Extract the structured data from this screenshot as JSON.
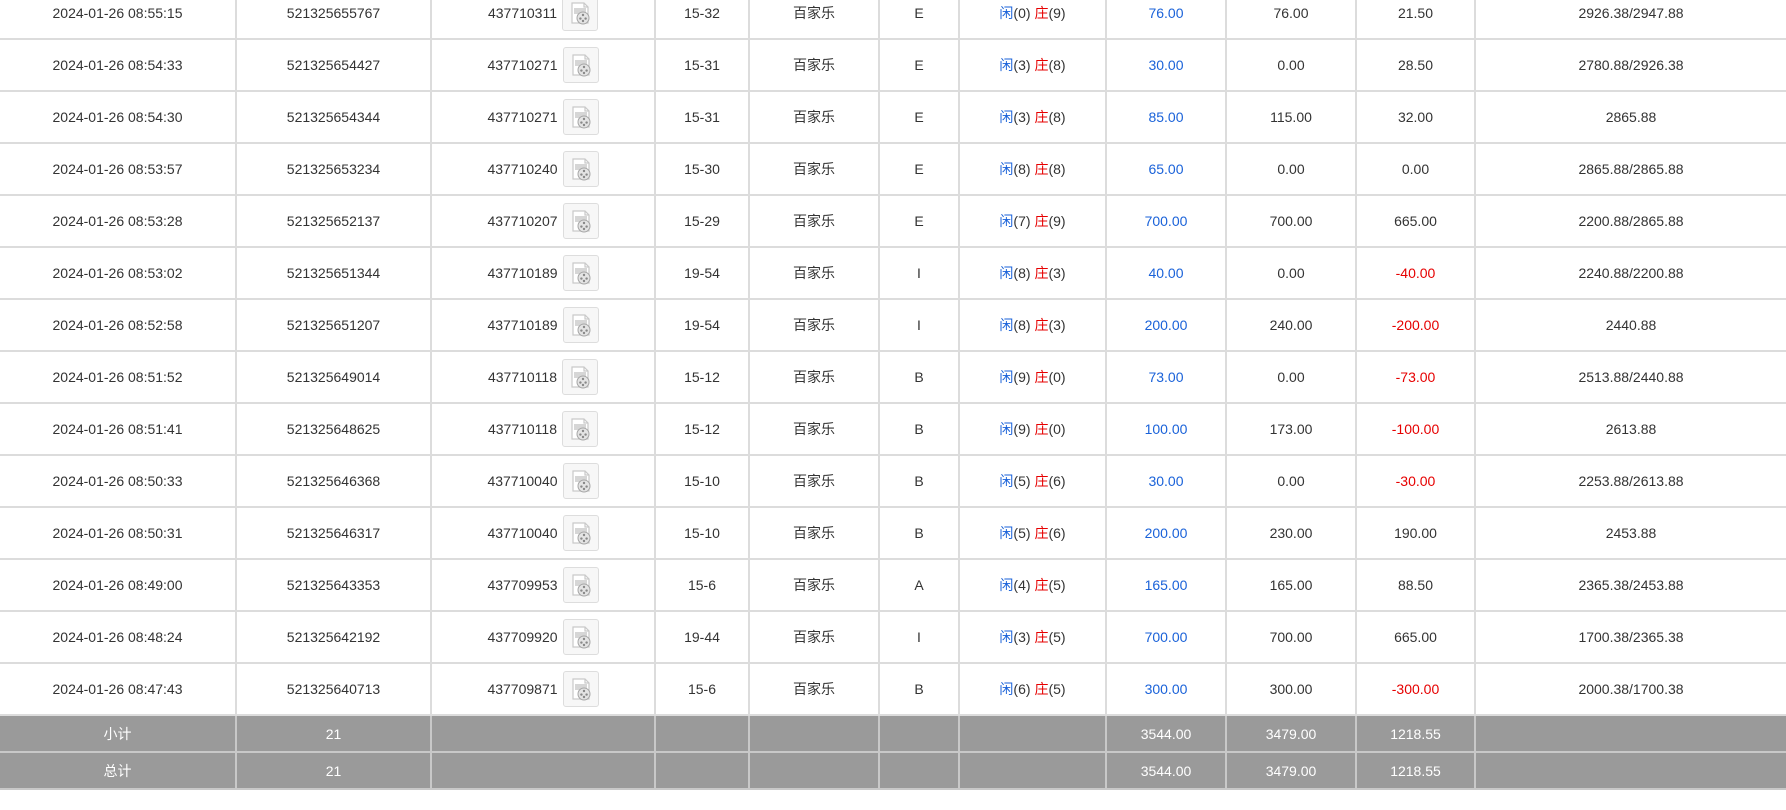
{
  "colors": {
    "bet_blue": "#1a62d9",
    "loss_red": "#e60000",
    "summary_bg": "#9a9a9a",
    "grid": "#dcdcdc"
  },
  "icon": "replay-video-icon",
  "rows": [
    {
      "time": "2024-01-26 08:55:15",
      "order": "521325655767",
      "round": "437710311",
      "table": "15-32",
      "game": "百家乐",
      "seat": "E",
      "p_label": "闲",
      "p_num": "(0)",
      "b_label": "庄",
      "b_num": "(9)",
      "bet": "76.00",
      "valid": "76.00",
      "payout": "21.50",
      "payout_neg": false,
      "balance": "2926.38/2947.88"
    },
    {
      "time": "2024-01-26 08:54:33",
      "order": "521325654427",
      "round": "437710271",
      "table": "15-31",
      "game": "百家乐",
      "seat": "E",
      "p_label": "闲",
      "p_num": "(3)",
      "b_label": "庄",
      "b_num": "(8)",
      "bet": "30.00",
      "valid": "0.00",
      "payout": "28.50",
      "payout_neg": false,
      "balance": "2780.88/2926.38"
    },
    {
      "time": "2024-01-26 08:54:30",
      "order": "521325654344",
      "round": "437710271",
      "table": "15-31",
      "game": "百家乐",
      "seat": "E",
      "p_label": "闲",
      "p_num": "(3)",
      "b_label": "庄",
      "b_num": "(8)",
      "bet": "85.00",
      "valid": "115.00",
      "payout": "32.00",
      "payout_neg": false,
      "balance": "2865.88"
    },
    {
      "time": "2024-01-26 08:53:57",
      "order": "521325653234",
      "round": "437710240",
      "table": "15-30",
      "game": "百家乐",
      "seat": "E",
      "p_label": "闲",
      "p_num": "(8)",
      "b_label": "庄",
      "b_num": "(8)",
      "bet": "65.00",
      "valid": "0.00",
      "payout": "0.00",
      "payout_neg": false,
      "balance": "2865.88/2865.88"
    },
    {
      "time": "2024-01-26 08:53:28",
      "order": "521325652137",
      "round": "437710207",
      "table": "15-29",
      "game": "百家乐",
      "seat": "E",
      "p_label": "闲",
      "p_num": "(7)",
      "b_label": "庄",
      "b_num": "(9)",
      "bet": "700.00",
      "valid": "700.00",
      "payout": "665.00",
      "payout_neg": false,
      "balance": "2200.88/2865.88"
    },
    {
      "time": "2024-01-26 08:53:02",
      "order": "521325651344",
      "round": "437710189",
      "table": "19-54",
      "game": "百家乐",
      "seat": "I",
      "p_label": "闲",
      "p_num": "(8)",
      "b_label": "庄",
      "b_num": "(3)",
      "bet": "40.00",
      "valid": "0.00",
      "payout": "-40.00",
      "payout_neg": true,
      "balance": "2240.88/2200.88"
    },
    {
      "time": "2024-01-26 08:52:58",
      "order": "521325651207",
      "round": "437710189",
      "table": "19-54",
      "game": "百家乐",
      "seat": "I",
      "p_label": "闲",
      "p_num": "(8)",
      "b_label": "庄",
      "b_num": "(3)",
      "bet": "200.00",
      "valid": "240.00",
      "payout": "-200.00",
      "payout_neg": true,
      "balance": "2440.88"
    },
    {
      "time": "2024-01-26 08:51:52",
      "order": "521325649014",
      "round": "437710118",
      "table": "15-12",
      "game": "百家乐",
      "seat": "B",
      "p_label": "闲",
      "p_num": "(9)",
      "b_label": "庄",
      "b_num": "(0)",
      "bet": "73.00",
      "valid": "0.00",
      "payout": "-73.00",
      "payout_neg": true,
      "balance": "2513.88/2440.88"
    },
    {
      "time": "2024-01-26 08:51:41",
      "order": "521325648625",
      "round": "437710118",
      "table": "15-12",
      "game": "百家乐",
      "seat": "B",
      "p_label": "闲",
      "p_num": "(9)",
      "b_label": "庄",
      "b_num": "(0)",
      "bet": "100.00",
      "valid": "173.00",
      "payout": "-100.00",
      "payout_neg": true,
      "balance": "2613.88"
    },
    {
      "time": "2024-01-26 08:50:33",
      "order": "521325646368",
      "round": "437710040",
      "table": "15-10",
      "game": "百家乐",
      "seat": "B",
      "p_label": "闲",
      "p_num": "(5)",
      "b_label": "庄",
      "b_num": "(6)",
      "bet": "30.00",
      "valid": "0.00",
      "payout": "-30.00",
      "payout_neg": true,
      "balance": "2253.88/2613.88"
    },
    {
      "time": "2024-01-26 08:50:31",
      "order": "521325646317",
      "round": "437710040",
      "table": "15-10",
      "game": "百家乐",
      "seat": "B",
      "p_label": "闲",
      "p_num": "(5)",
      "b_label": "庄",
      "b_num": "(6)",
      "bet": "200.00",
      "valid": "230.00",
      "payout": "190.00",
      "payout_neg": false,
      "balance": "2453.88"
    },
    {
      "time": "2024-01-26 08:49:00",
      "order": "521325643353",
      "round": "437709953",
      "table": "15-6",
      "game": "百家乐",
      "seat": "A",
      "p_label": "闲",
      "p_num": "(4)",
      "b_label": "庄",
      "b_num": "(5)",
      "bet": "165.00",
      "valid": "165.00",
      "payout": "88.50",
      "payout_neg": false,
      "balance": "2365.38/2453.88"
    },
    {
      "time": "2024-01-26 08:48:24",
      "order": "521325642192",
      "round": "437709920",
      "table": "19-44",
      "game": "百家乐",
      "seat": "I",
      "p_label": "闲",
      "p_num": "(3)",
      "b_label": "庄",
      "b_num": "(5)",
      "bet": "700.00",
      "valid": "700.00",
      "payout": "665.00",
      "payout_neg": false,
      "balance": "1700.38/2365.38"
    },
    {
      "time": "2024-01-26 08:47:43",
      "order": "521325640713",
      "round": "437709871",
      "table": "15-6",
      "game": "百家乐",
      "seat": "B",
      "p_label": "闲",
      "p_num": "(6)",
      "b_label": "庄",
      "b_num": "(5)",
      "bet": "300.00",
      "valid": "300.00",
      "payout": "-300.00",
      "payout_neg": true,
      "balance": "2000.38/1700.38"
    }
  ],
  "summary": [
    {
      "label": "小计",
      "count": "21",
      "bet": "3544.00",
      "valid": "3479.00",
      "payout": "1218.55"
    },
    {
      "label": "总计",
      "count": "21",
      "bet": "3544.00",
      "valid": "3479.00",
      "payout": "1218.55"
    }
  ]
}
